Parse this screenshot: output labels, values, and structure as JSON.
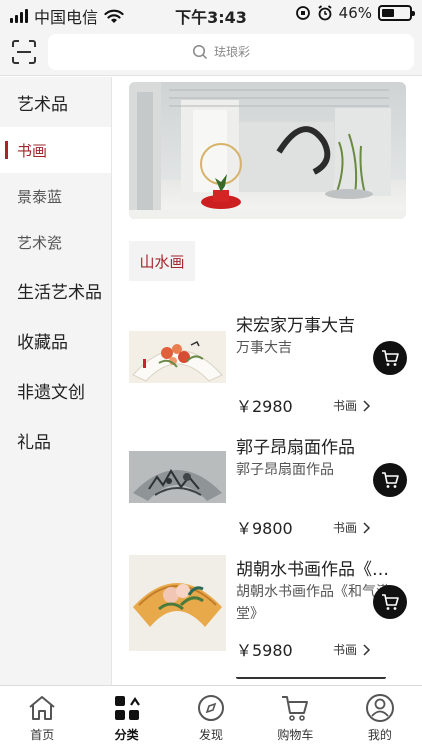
{
  "status_bar": {
    "carrier": "中国电信",
    "time": "下午3:43",
    "battery_text": "46%",
    "battery_level": 0.46
  },
  "search": {
    "placeholder": "珐琅彩"
  },
  "sidebar": {
    "items": [
      {
        "label": "艺术品"
      },
      {
        "label": "书画"
      },
      {
        "label": "景泰蓝"
      },
      {
        "label": "艺术瓷"
      },
      {
        "label": "生活艺术品"
      },
      {
        "label": "收藏品"
      },
      {
        "label": "非遗文创"
      },
      {
        "label": "礼品"
      }
    ],
    "active_label": "书画"
  },
  "section": {
    "tag": "山水画"
  },
  "products": [
    {
      "title": "宋宏家万事大吉",
      "subtitle": "万事大吉",
      "price": "￥2980",
      "category": "书画"
    },
    {
      "title": "郭子昂扇面作品",
      "subtitle": "郭子昂扇面作品",
      "price": "￥9800",
      "category": "书画"
    },
    {
      "title": "胡朝水书画作品《…",
      "subtitle": "胡朝水书画作品《和气满堂》",
      "price": "￥5980",
      "category": "书画"
    }
  ],
  "tabbar": {
    "tabs": [
      {
        "label": "首页"
      },
      {
        "label": "分类"
      },
      {
        "label": "发现"
      },
      {
        "label": "购物车"
      },
      {
        "label": "我的"
      }
    ],
    "active": "分类"
  },
  "colors": {
    "accent": "#a3262a",
    "sidebar_bg": "#f4f4f4"
  }
}
